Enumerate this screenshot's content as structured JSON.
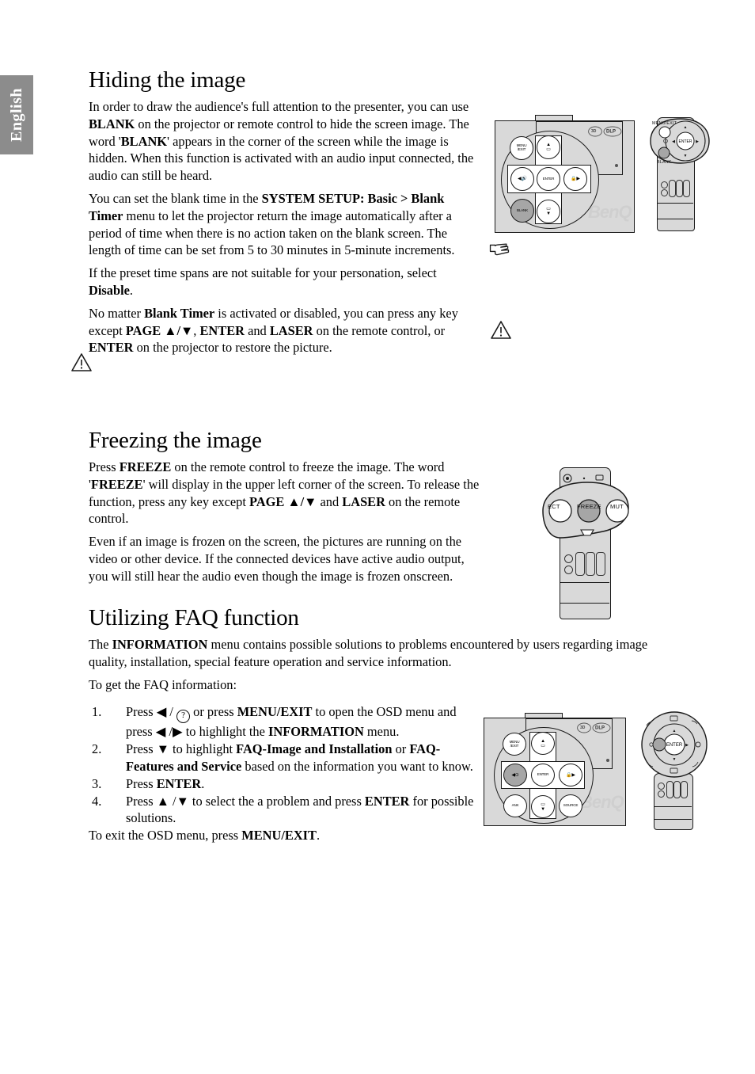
{
  "sidebar": {
    "language_tab": "English"
  },
  "sections": [
    {
      "id": "hiding",
      "title": "Hiding the image",
      "paragraphs": [
        {
          "runs": [
            {
              "t": "In order to draw the audience's full attention to the presenter, you can use ",
              "b": false
            },
            {
              "t": "BLANK",
              "b": true
            },
            {
              "t": " on the projector or remote control to hide the screen image. The word '",
              "b": false
            },
            {
              "t": "BLANK",
              "b": true
            },
            {
              "t": "' appears in the corner of the screen while the image is hidden. When this function is activated with an audio input connected, the audio can still be heard.",
              "b": false
            }
          ]
        },
        {
          "runs": [
            {
              "t": "You can set the blank time in the ",
              "b": false
            },
            {
              "t": "SYSTEM SETUP: Basic > Blank Timer",
              "b": true
            },
            {
              "t": " menu to let the projector return the image automatically after a period of time when there is no action taken on the blank screen. The length of time can be set from 5 to 30 minutes in 5-minute increments.",
              "b": false
            }
          ]
        },
        {
          "runs": [
            {
              "t": "If the preset time spans are not suitable for your personation, select ",
              "b": false
            },
            {
              "t": "Disable",
              "b": true
            },
            {
              "t": ".",
              "b": false
            }
          ]
        },
        {
          "runs": [
            {
              "t": "No matter ",
              "b": false
            },
            {
              "t": "Blank Timer",
              "b": true
            },
            {
              "t": " is activated or disabled, you can press any key except ",
              "b": false
            },
            {
              "t": "PAGE ▲/▼",
              "b": true
            },
            {
              "t": ", ",
              "b": false
            },
            {
              "t": "ENTER",
              "b": true
            },
            {
              "t": " and ",
              "b": false
            },
            {
              "t": "LASER",
              "b": true
            },
            {
              "t": " on the remote control, or ",
              "b": false
            },
            {
              "t": "ENTER",
              "b": true
            },
            {
              "t": " on the projector to restore the picture.",
              "b": false
            }
          ]
        }
      ]
    },
    {
      "id": "freezing",
      "title": "Freezing the image",
      "paragraphs": [
        {
          "runs": [
            {
              "t": "Press ",
              "b": false
            },
            {
              "t": "FREEZE",
              "b": true
            },
            {
              "t": " on the remote control to freeze the image. The word '",
              "b": false
            },
            {
              "t": "FREEZE",
              "b": true
            },
            {
              "t": "' will display in the upper left corner of the screen. To release the function, press any key except ",
              "b": false
            },
            {
              "t": "PAGE ▲/▼",
              "b": true
            },
            {
              "t": " and ",
              "b": false
            },
            {
              "t": "LASER",
              "b": true
            },
            {
              "t": " on the remote control.",
              "b": false
            }
          ]
        },
        {
          "runs": [
            {
              "t": "Even if an image is frozen on the screen, the pictures are running on the video or other device. If the connected devices have active audio output, you will still hear the audio even though the image is frozen onscreen.",
              "b": false
            }
          ]
        }
      ]
    },
    {
      "id": "faq",
      "title": "Utilizing FAQ function",
      "paragraphs": [
        {
          "runs": [
            {
              "t": "The ",
              "b": false
            },
            {
              "t": "INFORMATION",
              "b": true
            },
            {
              "t": " menu contains possible solutions to problems encountered by users regarding image quality, installation, special feature operation and service information.",
              "b": false
            }
          ]
        },
        {
          "runs": [
            {
              "t": "To get the FAQ information:",
              "b": false
            }
          ]
        }
      ],
      "steps": [
        {
          "num": "1.",
          "runs": [
            {
              "t": "Press ◀ / ",
              "b": false
            },
            {
              "t": "ⓘ",
              "b": false,
              "circleq": true
            },
            {
              "t": " or press ",
              "b": false
            },
            {
              "t": "MENU/EXIT",
              "b": true
            },
            {
              "t": " to open the OSD menu and press ◀ /▶  to highlight the ",
              "b": false
            },
            {
              "t": "INFORMATION",
              "b": true
            },
            {
              "t": " menu.",
              "b": false
            }
          ]
        },
        {
          "num": "2.",
          "runs": [
            {
              "t": "Press ▼  to highlight ",
              "b": false
            },
            {
              "t": "FAQ-Image and Installation",
              "b": true
            },
            {
              "t": " or ",
              "b": false
            },
            {
              "t": "FAQ-Features and Service",
              "b": true
            },
            {
              "t": " based on the information you want to know.",
              "b": false
            }
          ]
        },
        {
          "num": "3.",
          "runs": [
            {
              "t": "Press ",
              "b": false
            },
            {
              "t": "ENTER",
              "b": true
            },
            {
              "t": ".",
              "b": false
            }
          ]
        },
        {
          "num": "4.",
          "runs": [
            {
              "t": "Press ▲ /▼ to select the a problem and press ",
              "b": false
            },
            {
              "t": "ENTER",
              "b": true
            },
            {
              "t": " for possible solutions.",
              "b": false
            }
          ]
        }
      ],
      "closing": {
        "runs": [
          {
            "t": "To exit the OSD menu, press ",
            "b": false
          },
          {
            "t": "MENU/EXIT",
            "b": true
          },
          {
            "t": ".",
            "b": false
          }
        ]
      }
    }
  ],
  "icons": {
    "warning": "warning-triangle-icon",
    "hand": "pointing-hand-icon"
  },
  "illustrations": {
    "projector_panel_top": {
      "name": "projector-control-panel",
      "brand": "BenQ",
      "badge": "DLP",
      "keys": [
        {
          "name": "menu-exit-key",
          "label": "MENU\n/EXIT",
          "highlighted": false
        },
        {
          "name": "up-keystone-key",
          "label": "▲",
          "highlighted": false
        },
        {
          "name": "left-volume-key",
          "label": "◀",
          "highlighted": false
        },
        {
          "name": "enter-key",
          "label": "ENTER",
          "highlighted": false
        },
        {
          "name": "right-lock-key",
          "label": "▶",
          "highlighted": false
        },
        {
          "name": "blank-key",
          "label": "BLANK",
          "highlighted": true
        },
        {
          "name": "down-keystone-key",
          "label": "▼",
          "highlighted": false
        }
      ]
    },
    "remote_top": {
      "name": "remote-control-blank",
      "callout_label": "MENU/EXIT",
      "blank_label": "BLANK",
      "enter_label": "ENTER"
    },
    "remote_freeze": {
      "name": "remote-control-freeze",
      "callout_labels": [
        "ECT",
        "FREEZE",
        "MUT"
      ],
      "highlighted": "FREEZE"
    },
    "projector_panel_faq": {
      "name": "projector-control-panel-faq",
      "brand": "BenQ",
      "badge": "DLP",
      "keys": [
        {
          "name": "menu-exit-key",
          "label": "MENU\n/EXIT",
          "highlighted": false
        },
        {
          "name": "up-keystone-key",
          "label": "▲",
          "highlighted": false
        },
        {
          "name": "left-help-key",
          "label": "◀",
          "highlighted": true
        },
        {
          "name": "enter-key",
          "label": "ENTER",
          "highlighted": false
        },
        {
          "name": "right-lock-key",
          "label": "▶",
          "highlighted": false
        },
        {
          "name": "blank-key",
          "label": "ANK",
          "highlighted": false
        },
        {
          "name": "down-keystone-key",
          "label": "▼",
          "highlighted": false
        },
        {
          "name": "source-key",
          "label": "SOURCE",
          "highlighted": false
        }
      ]
    },
    "remote_faq": {
      "name": "remote-control-faq",
      "enter_label": "ENTER"
    }
  },
  "colors": {
    "tab_bg": "#8c8c8c",
    "device_fill": "#d9d9d9",
    "highlight_key": "#a6a6a6",
    "outline": "#1a1a1a",
    "text": "#000000"
  }
}
